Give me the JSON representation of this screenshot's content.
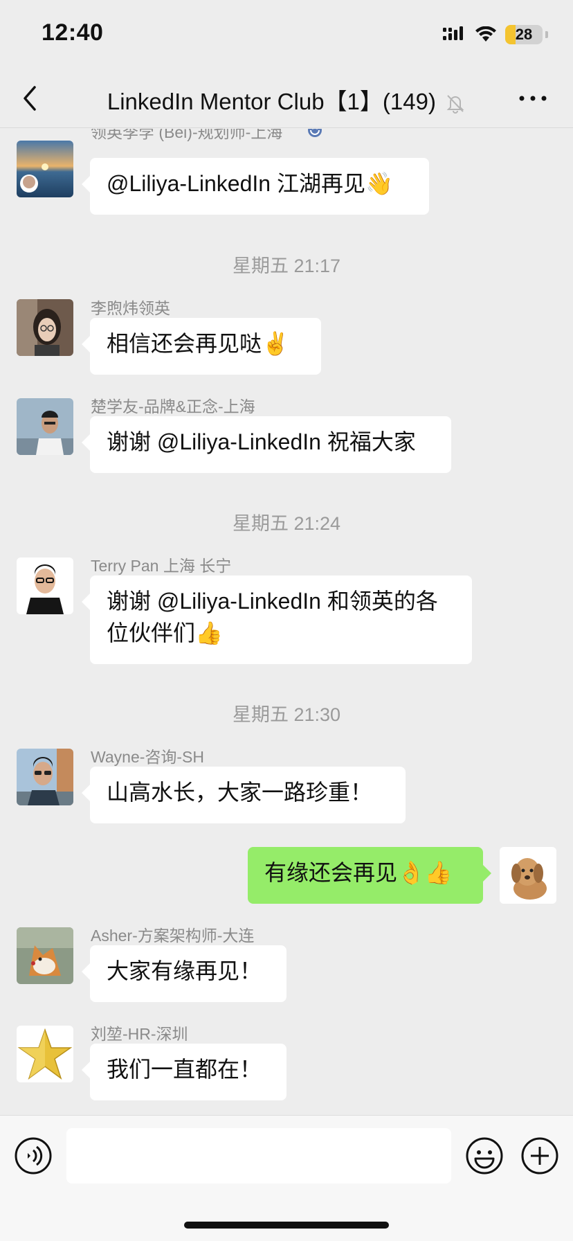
{
  "status_bar": {
    "time": "12:40",
    "battery_level": "28",
    "battery_fraction": 0.28,
    "icons": [
      "cellular-signal-icon",
      "wifi-icon",
      "battery-icon"
    ]
  },
  "header": {
    "title": "LinkedIn Mentor Club【1】(149)",
    "icons": [
      "back-chevron-icon",
      "mute-bell-icon",
      "more-dots-icon"
    ]
  },
  "messages": [
    {
      "type": "msg",
      "sender": "领英李孛 (Bèi)-规划师-上海",
      "text": "@Liliya-LinkedIn 江湖再见👋",
      "avatar": "sunset-sea-avatar"
    },
    {
      "type": "time",
      "text": "星期五 21:17"
    },
    {
      "type": "msg",
      "sender": "李煦炜领英",
      "text": "相信还会再见哒✌️",
      "avatar": "woman-glasses-avatar"
    },
    {
      "type": "msg",
      "sender": "楚学友-品牌&正念-上海",
      "text": "谢谢 @Liliya-LinkedIn 祝福大家",
      "avatar": "man-outdoor-avatar"
    },
    {
      "type": "time",
      "text": "星期五 21:24"
    },
    {
      "type": "msg",
      "sender": "Terry Pan 上海 长宁",
      "text_lines": [
        "谢谢 @Liliya-LinkedIn 和领英的各",
        "位伙伴们👍"
      ],
      "avatar": "man-black-shirt-avatar"
    },
    {
      "type": "time",
      "text": "星期五 21:30"
    },
    {
      "type": "msg",
      "sender": "Wayne-咨询-SH",
      "text": "山高水长，大家一路珍重！",
      "avatar": "man-sunglasses-avatar"
    },
    {
      "type": "self",
      "text": "有缘还会再见👌👍",
      "avatar": "puppy-avatar"
    },
    {
      "type": "msg",
      "sender": "Asher-方案架构师-大连",
      "text": "大家有缘再见！",
      "avatar": "shiba-dog-avatar"
    },
    {
      "type": "msg",
      "sender": "刘堃-HR-深圳",
      "text": "我们一直都在！",
      "avatar": "gold-star-avatar"
    }
  ],
  "input_bar": {
    "value": "",
    "icons": [
      "voice-input-icon",
      "emoji-icon",
      "add-plus-icon"
    ]
  },
  "colors": {
    "background": "#ededed",
    "incoming_bubble": "#ffffff",
    "outgoing_bubble": "#95ec69",
    "battery_accent": "#f4c430"
  }
}
